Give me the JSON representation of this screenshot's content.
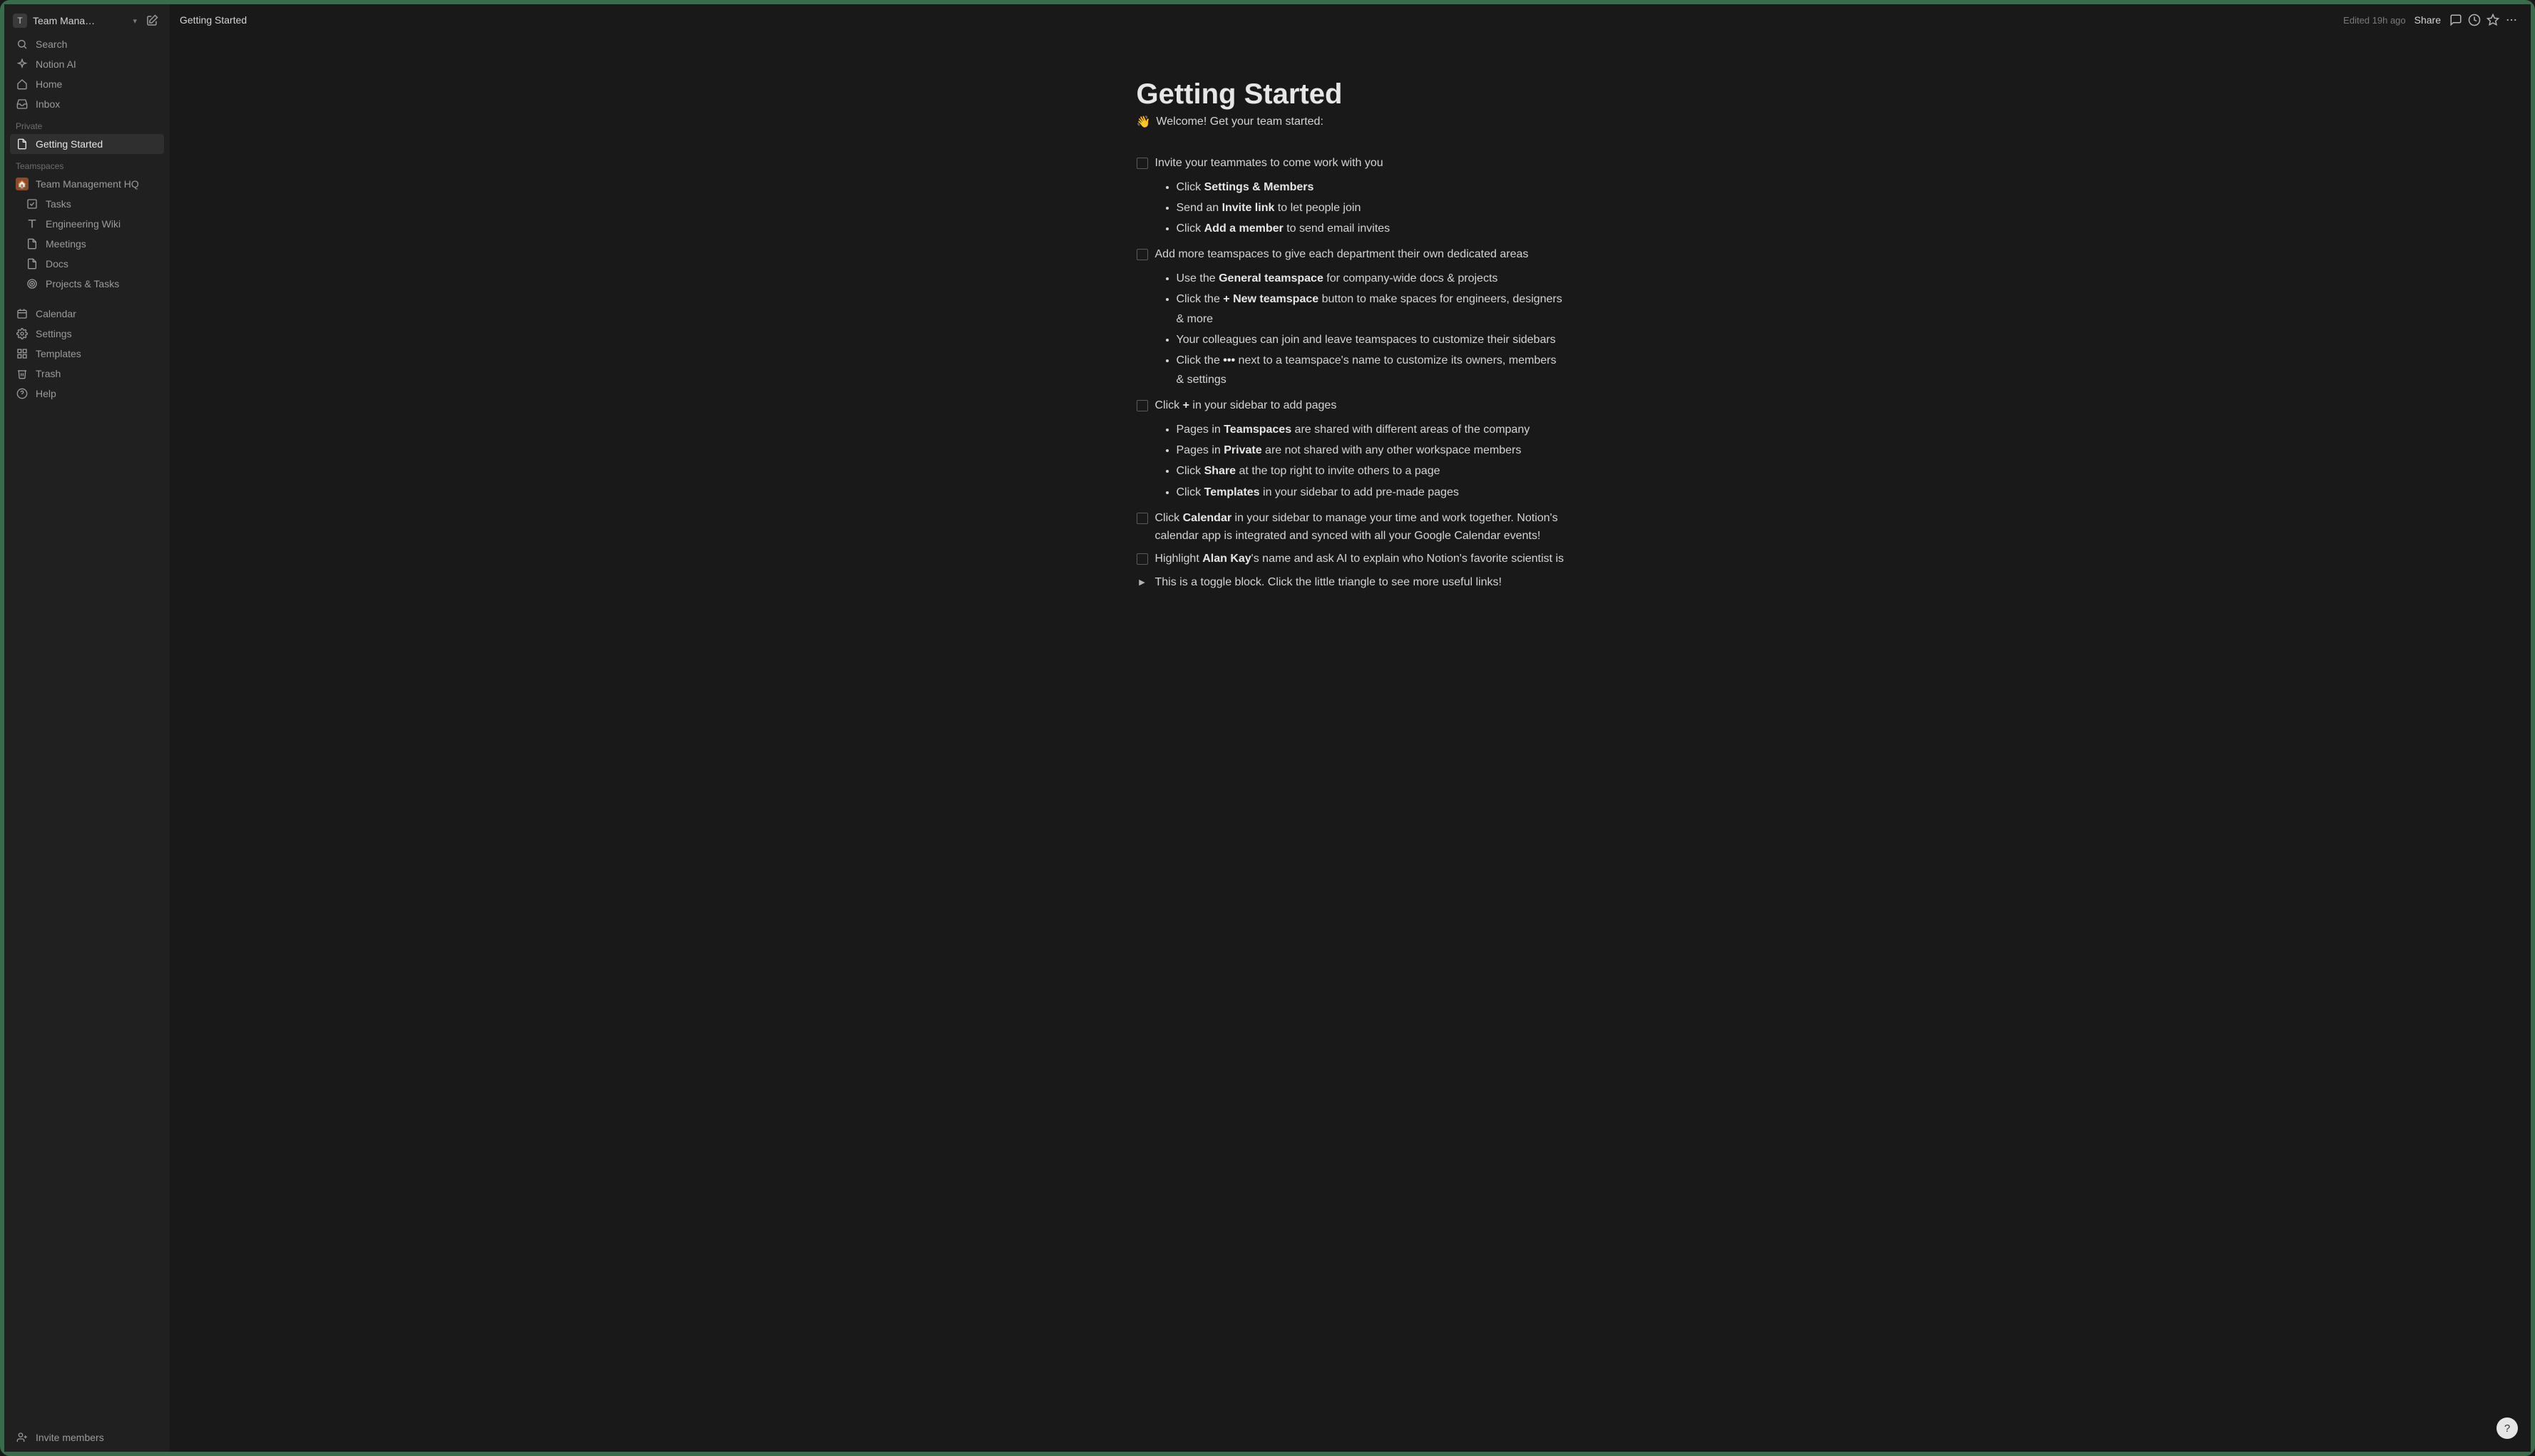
{
  "workspace": {
    "initial": "T",
    "name": "Team Mana…"
  },
  "sidebar": {
    "top": [
      {
        "icon": "search",
        "label": "Search"
      },
      {
        "icon": "sparkle",
        "label": "Notion AI"
      },
      {
        "icon": "home",
        "label": "Home"
      },
      {
        "icon": "inbox",
        "label": "Inbox"
      }
    ],
    "private_label": "Private",
    "private_items": [
      {
        "icon": "page",
        "label": "Getting Started",
        "active": true
      }
    ],
    "teamspaces_label": "Teamspaces",
    "teamspace_name": "Team Management HQ",
    "teamspace_items": [
      {
        "icon": "check",
        "label": "Tasks"
      },
      {
        "icon": "book",
        "label": "Engineering Wiki"
      },
      {
        "icon": "page",
        "label": "Meetings"
      },
      {
        "icon": "page",
        "label": "Docs"
      },
      {
        "icon": "target",
        "label": "Projects & Tasks"
      }
    ],
    "bottom": [
      {
        "icon": "calendar",
        "label": "Calendar"
      },
      {
        "icon": "gear",
        "label": "Settings"
      },
      {
        "icon": "templates",
        "label": "Templates"
      },
      {
        "icon": "trash",
        "label": "Trash"
      },
      {
        "icon": "help",
        "label": "Help"
      }
    ],
    "invite": "Invite members"
  },
  "topbar": {
    "breadcrumb": "Getting Started",
    "edited": "Edited 19h ago",
    "share": "Share"
  },
  "page": {
    "title": "Getting Started",
    "welcome_emoji": "👋",
    "welcome": "Welcome! Get your team started:",
    "todos": [
      {
        "text": "Invite your teammates to come work with you",
        "subs": [
          {
            "pre": "Click ",
            "bold": "Settings & Members",
            "post": ""
          },
          {
            "pre": "Send an ",
            "bold": "Invite link",
            "post": " to let people join"
          },
          {
            "pre": "Click ",
            "bold": "Add a member",
            "post": " to send email invites"
          }
        ]
      },
      {
        "text": "Add more teamspaces to give each department their own dedicated areas",
        "subs": [
          {
            "pre": "Use the ",
            "bold": "General teamspace",
            "post": " for company-wide docs & projects"
          },
          {
            "pre": "Click the ",
            "bold": "+ New teamspace",
            "post": " button to make spaces for engineers, designers & more"
          },
          {
            "pre": "Your colleagues can join and leave teamspaces to customize their sidebars",
            "bold": "",
            "post": ""
          },
          {
            "pre": "Click the ",
            "bold": "•••",
            "post": " next to a teamspace's name to customize its owners, members & settings"
          }
        ]
      },
      {
        "text_pre": "Click ",
        "text_bold": "+",
        "text_post": " in your sidebar to add pages",
        "subs": [
          {
            "pre": "Pages in ",
            "bold": "Teamspaces",
            "post": " are shared with different areas of the company"
          },
          {
            "pre": "Pages in ",
            "bold": "Private",
            "post": " are not shared with any other workspace members"
          },
          {
            "pre": "Click ",
            "bold": "Share",
            "post": " at the top right to invite others to a page"
          },
          {
            "pre": "Click ",
            "bold": "Templates",
            "post": " in your sidebar to add pre-made pages"
          }
        ]
      },
      {
        "text_pre": "Click ",
        "text_bold": "Calendar",
        "text_post": " in your sidebar to manage your time and work together. Notion's calendar app is integrated and synced with all your Google Calendar events!",
        "subs": []
      },
      {
        "text_pre": "Highlight ",
        "text_bold": "Alan Kay",
        "text_post": "'s name and ask AI to explain who Notion's favorite scientist is",
        "subs": []
      }
    ],
    "toggle": "This is a toggle block. Click the little triangle to see more useful links!"
  },
  "help_badge": "?"
}
